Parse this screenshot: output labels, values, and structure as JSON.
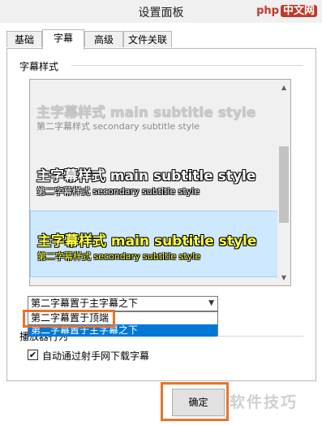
{
  "window": {
    "title": "设置面板"
  },
  "watermark_top": {
    "text": "php",
    "badge": "中文网"
  },
  "tabs": [
    {
      "label": "基础",
      "active": false
    },
    {
      "label": "字幕",
      "active": true
    },
    {
      "label": "高级",
      "active": false
    },
    {
      "label": "文件关联",
      "active": false
    }
  ],
  "subtitle_style": {
    "section_label": "字幕样式",
    "items": [
      {
        "main": "主字幕样式 main subtitle style",
        "sub": "第二字幕样式 secondary subtitle style",
        "main_color": "#c8c8c8",
        "sub_color": "#8a8a8a",
        "selected": false
      },
      {
        "main": "主字幕样式 main subtitle style",
        "sub": "第二字幕样式 secondary subtitle style",
        "main_color": "#ffffff",
        "sub_color": "#ffffff",
        "selected": false
      },
      {
        "main": "主字幕样式 main subtitle style",
        "sub": "第二字幕样式 secondary subtitle style",
        "main_color": "#ffff3c",
        "sub_color": "#ffff3c",
        "selected": true
      }
    ]
  },
  "position_select": {
    "value": "第二字幕置于主字幕之下",
    "options": [
      {
        "label": "第二字幕置于顶端",
        "highlighted": false
      },
      {
        "label": "第二字幕置于主字幕之下",
        "highlighted": true
      }
    ]
  },
  "player": {
    "section_label": "播放器行为",
    "auto_download_label": "自动通过射手网下载字幕",
    "auto_download_checked": true,
    "checkmark": "✔"
  },
  "buttons": {
    "ok_label": "确定"
  },
  "watermark_bottom": {
    "text": "软件技巧"
  },
  "colors": {
    "accent": "#0078d7",
    "highlight_orange": "#e8742a",
    "selection_bg": "#cde8ff"
  }
}
